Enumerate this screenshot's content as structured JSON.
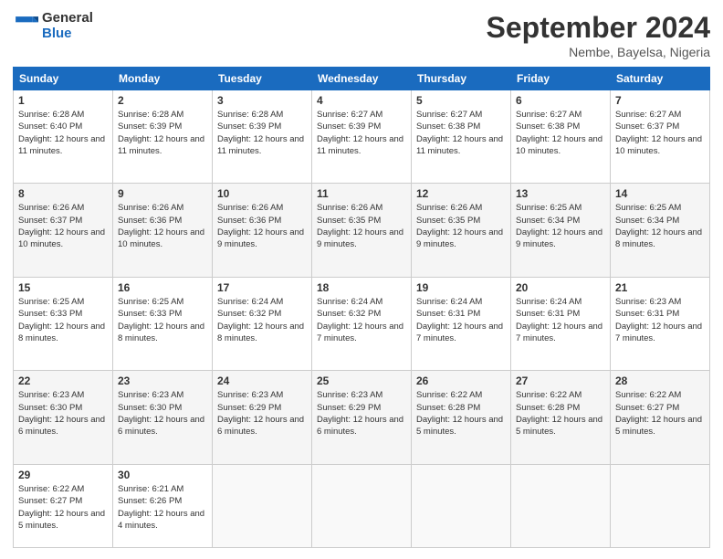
{
  "header": {
    "logo_general": "General",
    "logo_blue": "Blue",
    "title": "September 2024",
    "location": "Nembe, Bayelsa, Nigeria"
  },
  "columns": [
    "Sunday",
    "Monday",
    "Tuesday",
    "Wednesday",
    "Thursday",
    "Friday",
    "Saturday"
  ],
  "weeks": [
    [
      {
        "day": "1",
        "sunrise": "Sunrise: 6:28 AM",
        "sunset": "Sunset: 6:40 PM",
        "daylight": "Daylight: 12 hours and 11 minutes."
      },
      {
        "day": "2",
        "sunrise": "Sunrise: 6:28 AM",
        "sunset": "Sunset: 6:39 PM",
        "daylight": "Daylight: 12 hours and 11 minutes."
      },
      {
        "day": "3",
        "sunrise": "Sunrise: 6:28 AM",
        "sunset": "Sunset: 6:39 PM",
        "daylight": "Daylight: 12 hours and 11 minutes."
      },
      {
        "day": "4",
        "sunrise": "Sunrise: 6:27 AM",
        "sunset": "Sunset: 6:39 PM",
        "daylight": "Daylight: 12 hours and 11 minutes."
      },
      {
        "day": "5",
        "sunrise": "Sunrise: 6:27 AM",
        "sunset": "Sunset: 6:38 PM",
        "daylight": "Daylight: 12 hours and 11 minutes."
      },
      {
        "day": "6",
        "sunrise": "Sunrise: 6:27 AM",
        "sunset": "Sunset: 6:38 PM",
        "daylight": "Daylight: 12 hours and 10 minutes."
      },
      {
        "day": "7",
        "sunrise": "Sunrise: 6:27 AM",
        "sunset": "Sunset: 6:37 PM",
        "daylight": "Daylight: 12 hours and 10 minutes."
      }
    ],
    [
      {
        "day": "8",
        "sunrise": "Sunrise: 6:26 AM",
        "sunset": "Sunset: 6:37 PM",
        "daylight": "Daylight: 12 hours and 10 minutes."
      },
      {
        "day": "9",
        "sunrise": "Sunrise: 6:26 AM",
        "sunset": "Sunset: 6:36 PM",
        "daylight": "Daylight: 12 hours and 10 minutes."
      },
      {
        "day": "10",
        "sunrise": "Sunrise: 6:26 AM",
        "sunset": "Sunset: 6:36 PM",
        "daylight": "Daylight: 12 hours and 9 minutes."
      },
      {
        "day": "11",
        "sunrise": "Sunrise: 6:26 AM",
        "sunset": "Sunset: 6:35 PM",
        "daylight": "Daylight: 12 hours and 9 minutes."
      },
      {
        "day": "12",
        "sunrise": "Sunrise: 6:26 AM",
        "sunset": "Sunset: 6:35 PM",
        "daylight": "Daylight: 12 hours and 9 minutes."
      },
      {
        "day": "13",
        "sunrise": "Sunrise: 6:25 AM",
        "sunset": "Sunset: 6:34 PM",
        "daylight": "Daylight: 12 hours and 9 minutes."
      },
      {
        "day": "14",
        "sunrise": "Sunrise: 6:25 AM",
        "sunset": "Sunset: 6:34 PM",
        "daylight": "Daylight: 12 hours and 8 minutes."
      }
    ],
    [
      {
        "day": "15",
        "sunrise": "Sunrise: 6:25 AM",
        "sunset": "Sunset: 6:33 PM",
        "daylight": "Daylight: 12 hours and 8 minutes."
      },
      {
        "day": "16",
        "sunrise": "Sunrise: 6:25 AM",
        "sunset": "Sunset: 6:33 PM",
        "daylight": "Daylight: 12 hours and 8 minutes."
      },
      {
        "day": "17",
        "sunrise": "Sunrise: 6:24 AM",
        "sunset": "Sunset: 6:32 PM",
        "daylight": "Daylight: 12 hours and 8 minutes."
      },
      {
        "day": "18",
        "sunrise": "Sunrise: 6:24 AM",
        "sunset": "Sunset: 6:32 PM",
        "daylight": "Daylight: 12 hours and 7 minutes."
      },
      {
        "day": "19",
        "sunrise": "Sunrise: 6:24 AM",
        "sunset": "Sunset: 6:31 PM",
        "daylight": "Daylight: 12 hours and 7 minutes."
      },
      {
        "day": "20",
        "sunrise": "Sunrise: 6:24 AM",
        "sunset": "Sunset: 6:31 PM",
        "daylight": "Daylight: 12 hours and 7 minutes."
      },
      {
        "day": "21",
        "sunrise": "Sunrise: 6:23 AM",
        "sunset": "Sunset: 6:31 PM",
        "daylight": "Daylight: 12 hours and 7 minutes."
      }
    ],
    [
      {
        "day": "22",
        "sunrise": "Sunrise: 6:23 AM",
        "sunset": "Sunset: 6:30 PM",
        "daylight": "Daylight: 12 hours and 6 minutes."
      },
      {
        "day": "23",
        "sunrise": "Sunrise: 6:23 AM",
        "sunset": "Sunset: 6:30 PM",
        "daylight": "Daylight: 12 hours and 6 minutes."
      },
      {
        "day": "24",
        "sunrise": "Sunrise: 6:23 AM",
        "sunset": "Sunset: 6:29 PM",
        "daylight": "Daylight: 12 hours and 6 minutes."
      },
      {
        "day": "25",
        "sunrise": "Sunrise: 6:23 AM",
        "sunset": "Sunset: 6:29 PM",
        "daylight": "Daylight: 12 hours and 6 minutes."
      },
      {
        "day": "26",
        "sunrise": "Sunrise: 6:22 AM",
        "sunset": "Sunset: 6:28 PM",
        "daylight": "Daylight: 12 hours and 5 minutes."
      },
      {
        "day": "27",
        "sunrise": "Sunrise: 6:22 AM",
        "sunset": "Sunset: 6:28 PM",
        "daylight": "Daylight: 12 hours and 5 minutes."
      },
      {
        "day": "28",
        "sunrise": "Sunrise: 6:22 AM",
        "sunset": "Sunset: 6:27 PM",
        "daylight": "Daylight: 12 hours and 5 minutes."
      }
    ],
    [
      {
        "day": "29",
        "sunrise": "Sunrise: 6:22 AM",
        "sunset": "Sunset: 6:27 PM",
        "daylight": "Daylight: 12 hours and 5 minutes."
      },
      {
        "day": "30",
        "sunrise": "Sunrise: 6:21 AM",
        "sunset": "Sunset: 6:26 PM",
        "daylight": "Daylight: 12 hours and 4 minutes."
      },
      null,
      null,
      null,
      null,
      null
    ]
  ]
}
